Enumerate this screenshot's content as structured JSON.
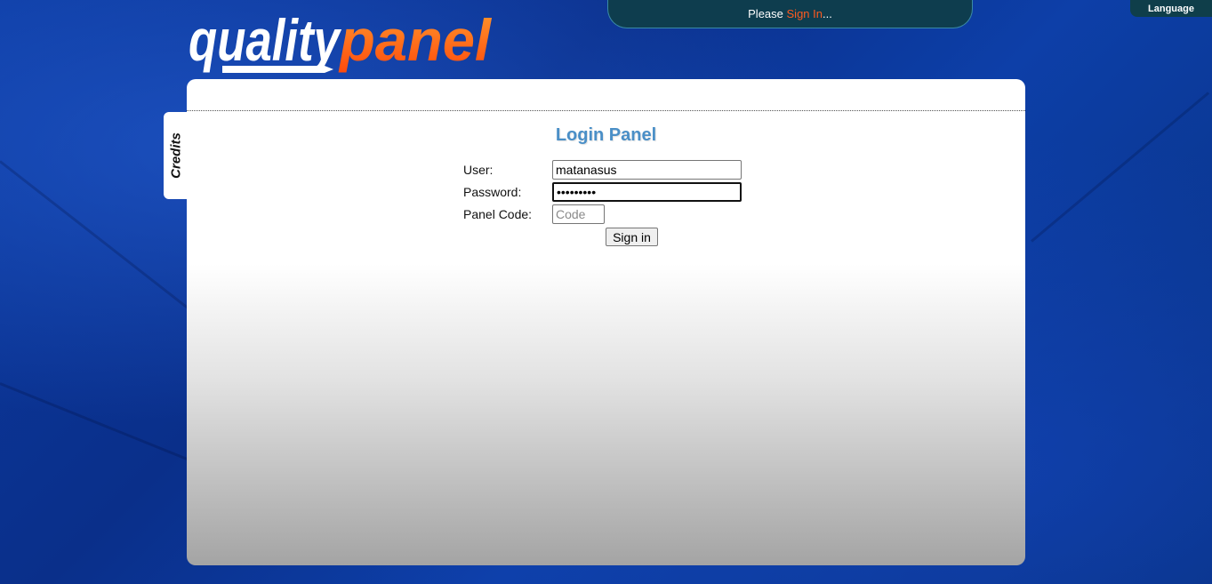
{
  "logo": {
    "part1": "quality",
    "part2": "panel"
  },
  "status_bar": {
    "prefix": "Please ",
    "link": "Sign In",
    "suffix": "..."
  },
  "language_tab": {
    "label": "Language"
  },
  "credits_tab": {
    "label": "Credits"
  },
  "login": {
    "title": "Login Panel",
    "user_label": "User:",
    "user_value": "matanasus",
    "password_label": "Password:",
    "password_value": "•••••••••",
    "panel_code_label": "Panel Code:",
    "panel_code_placeholder": "Code",
    "submit_label": "Sign in"
  },
  "colors": {
    "accent_orange": "#ff5a1f",
    "title_blue": "#4a8fc7",
    "background_blue": "#0c3aa0"
  }
}
